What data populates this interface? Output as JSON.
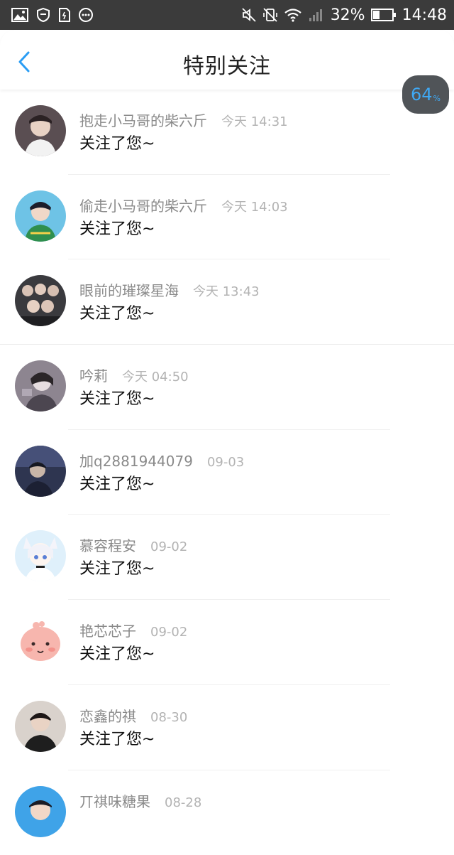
{
  "status_bar": {
    "battery_percent": "32%",
    "time": "14:48",
    "left_icons": [
      "image-icon",
      "shield-icon",
      "sim-icon",
      "more-dots-icon"
    ],
    "right_icons": [
      "mute-icon",
      "vibrate-off-icon",
      "wifi-icon",
      "signal-icon",
      "battery-icon"
    ]
  },
  "header": {
    "title": "特别关注",
    "back_icon": "chevron-left-icon",
    "accent_color": "#2a9df4"
  },
  "floating_badge": {
    "value": "64",
    "unit": "%",
    "color": "#3fa9f5"
  },
  "items": [
    {
      "name": "抱走小马哥的柴六斤",
      "time": "今天 14:31",
      "action": "关注了您~"
    },
    {
      "name": "偷走小马哥的柴六斤",
      "time": "今天 14:03",
      "action": "关注了您~"
    },
    {
      "name": "眼前的璀璨星海",
      "time": "今天 13:43",
      "action": "关注了您~"
    },
    {
      "name": "吟莉",
      "time": "今天 04:50",
      "action": "关注了您~"
    },
    {
      "name": "加q2881944079",
      "time": "09-03",
      "action": "关注了您~"
    },
    {
      "name": "慕容程安",
      "time": "09-02",
      "action": "关注了您~"
    },
    {
      "name": "艳芯芯子",
      "time": "09-02",
      "action": "关注了您~"
    },
    {
      "name": "恋鑫的祺",
      "time": "08-30",
      "action": "关注了您~"
    },
    {
      "name": "丌祺味糖果",
      "time": "08-28",
      "action": ""
    }
  ]
}
